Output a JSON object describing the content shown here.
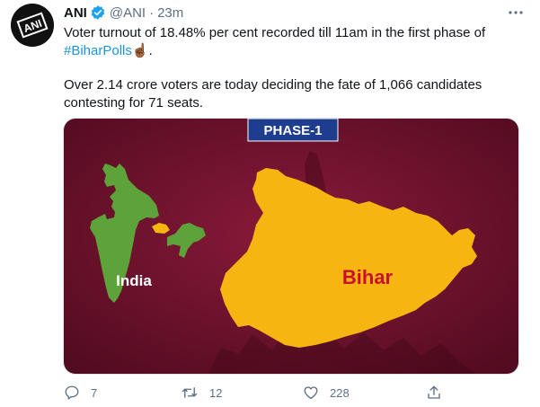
{
  "tweet": {
    "author_name": "ANI",
    "handle": "@ANI",
    "separator": "·",
    "time": "23m",
    "text_line1": "Voter turnout of 18.48% per cent recorded till 11am in the first phase of",
    "hashtag": "#BiharPolls",
    "hashtag_suffix_emoji": "☝🏾",
    "hashtag_suffix": ".",
    "text_para2": "Over 2.14 crore voters are today deciding the fate of 1,066 candidates contesting for 71 seats."
  },
  "media": {
    "banner": "PHASE-1",
    "label_india": "India",
    "label_bihar": "Bihar"
  },
  "actions": {
    "replies": "7",
    "retweets": "12",
    "likes": "228"
  },
  "icons": {
    "avatar": "ani-logo-icon",
    "verified": "verified-badge-icon",
    "more": "more-options-icon",
    "reply": "reply-icon",
    "retweet": "retweet-icon",
    "like": "heart-icon",
    "share": "share-icon"
  },
  "colors": {
    "accent": "#1da1f2",
    "hashtag": "#1b95e0",
    "muted_text": "#5b7083",
    "media_background": "#6b0f2a",
    "banner_background": "#1f3d8f",
    "map_fill": "#f7b512",
    "india_fill": "#5ea33a",
    "bihar_label": "#c8102e"
  }
}
